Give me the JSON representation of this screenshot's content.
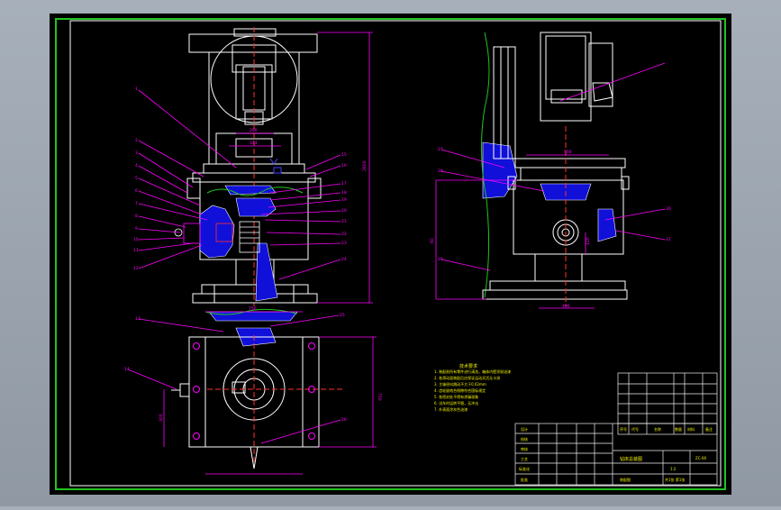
{
  "colors": {
    "background": "#000000",
    "outer_frame": "#21c321",
    "drawing": "#ffffff",
    "leader": "#ff00ff",
    "section_fill": "#1010d8",
    "title_block": "#f0f000",
    "notes": "#f0f000"
  },
  "dimensions": {
    "top_width_1": "200",
    "top_width_2": "324",
    "overall_height": "2600",
    "base_width": "750",
    "side_top_width": "500",
    "side_bottom_width": "400",
    "side_height": "60",
    "plan_height": "750",
    "plan_offset": "300",
    "side_small": "120"
  },
  "balloons_left": [
    "1",
    "2",
    "3",
    "4",
    "5",
    "6",
    "7",
    "8",
    "9",
    "10",
    "11",
    "12"
  ],
  "balloons_right_front": [
    "15",
    "16",
    "17",
    "18",
    "19",
    "20",
    "21",
    "22",
    "23",
    "24"
  ],
  "balloons_plan": [
    "13",
    "25",
    "14",
    "26"
  ],
  "balloons_side": [
    "27",
    "28",
    "29",
    "30",
    "31"
  ],
  "notes": {
    "heading": "技术要求",
    "lines": [
      "1. 装配前所有零件进行清洗，箱体内壁涂耐油漆",
      "2. 各滑动面装配后应保证运动灵活无卡滞",
      "3. 主轴径向跳动不大于0.02mm",
      "4. 齿轮副啮合侧隙符合国标规定",
      "5. 各密封处不得有渗漏现象",
      "6. 试车时运转平稳，无冲击",
      "7. 外表面涂灰色油漆"
    ]
  },
  "title_block": {
    "drawing_name": "钻床总装图",
    "drawing_no": "ZC-00",
    "scale": "1:2",
    "sheet": "共1张 第1张",
    "material": "装配图",
    "rows_left": [
      "设计",
      "校核",
      "审核",
      "工艺",
      "标准化",
      "批准"
    ],
    "rows_right": [
      "序号",
      "代号",
      "名称",
      "数量",
      "材料",
      "备注"
    ]
  }
}
